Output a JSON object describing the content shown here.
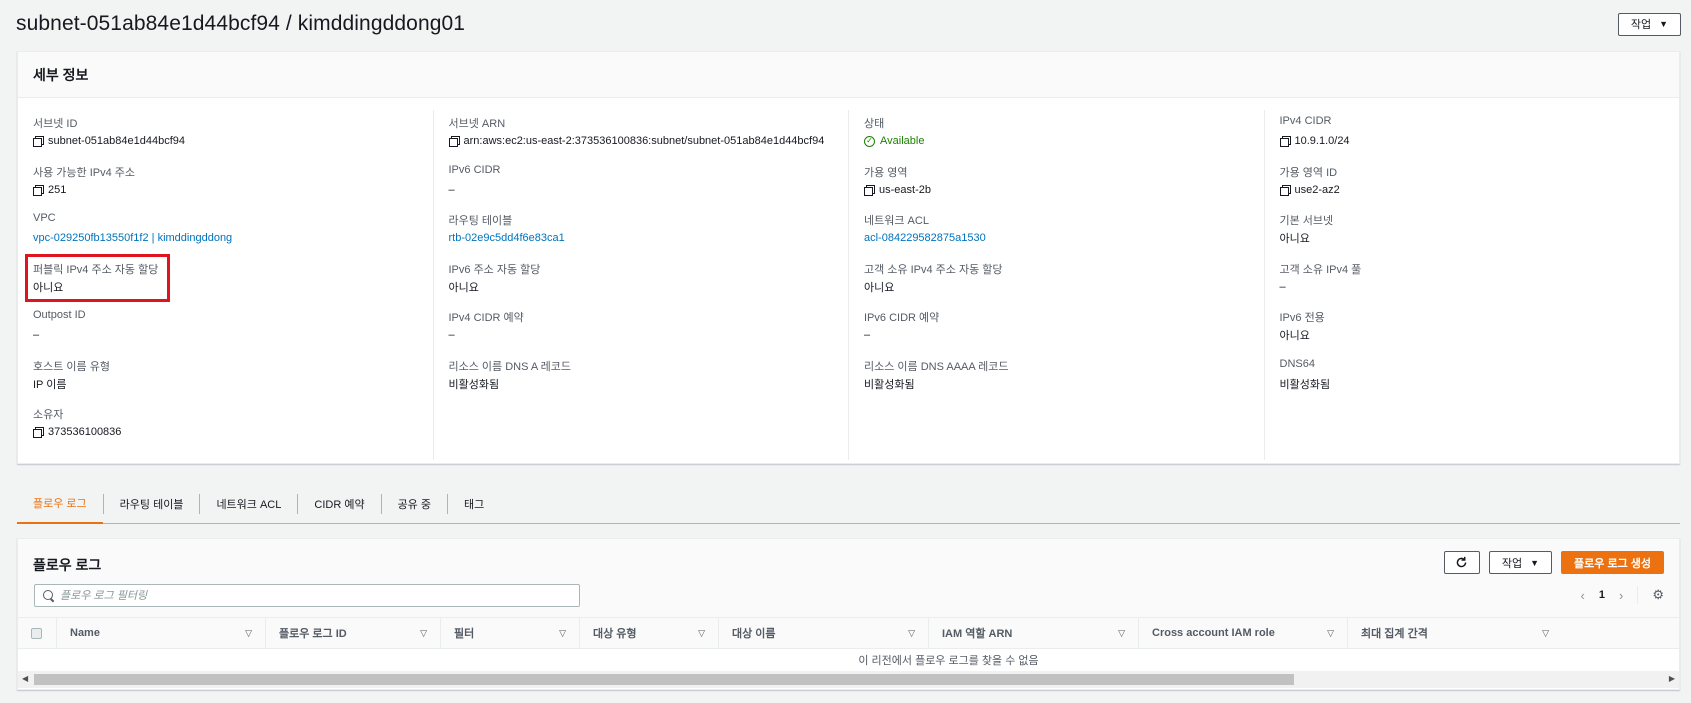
{
  "header": {
    "title": "subnet-051ab84e1d44bcf94 / kimddingddong01",
    "action_label": "작업"
  },
  "details": {
    "title": "세부 정보",
    "columns": [
      [
        {
          "label": "서브넷 ID",
          "value": "subnet-051ab84e1d44bcf94",
          "kind": "copy"
        },
        {
          "label": "사용 가능한 IPv4 주소",
          "value": "251",
          "kind": "copy"
        },
        {
          "label": "VPC",
          "value": "vpc-029250fb13550f1f2 | kimddingddong",
          "kind": "link"
        },
        {
          "label": "퍼블릭 IPv4 주소 자동 할당",
          "value": "아니요",
          "kind": "text"
        },
        {
          "label": "Outpost ID",
          "value": "–",
          "kind": "text"
        },
        {
          "label": "호스트 이름 유형",
          "value": "IP 이름",
          "kind": "text"
        },
        {
          "label": "소유자",
          "value": "373536100836",
          "kind": "copy"
        }
      ],
      [
        {
          "label": "서브넷 ARN",
          "value": "arn:aws:ec2:us-east-2:373536100836:subnet/subnet-051ab84e1d44bcf94",
          "kind": "copy"
        },
        {
          "label": "IPv6 CIDR",
          "value": "–",
          "kind": "text"
        },
        {
          "label": "라우팅 테이블",
          "value": "rtb-02e9c5dd4f6e83ca1",
          "kind": "link"
        },
        {
          "label": "IPv6 주소 자동 할당",
          "value": "아니요",
          "kind": "text"
        },
        {
          "label": "IPv4 CIDR 예약",
          "value": "–",
          "kind": "text"
        },
        {
          "label": "리소스 이름 DNS A 레코드",
          "value": "비활성화됨",
          "kind": "text"
        }
      ],
      [
        {
          "label": "상태",
          "value": "Available",
          "kind": "ok"
        },
        {
          "label": "가용 영역",
          "value": "us-east-2b",
          "kind": "copy"
        },
        {
          "label": "네트워크 ACL",
          "value": "acl-084229582875a1530",
          "kind": "link"
        },
        {
          "label": "고객 소유 IPv4 주소 자동 할당",
          "value": "아니요",
          "kind": "text"
        },
        {
          "label": "IPv6 CIDR 예약",
          "value": "–",
          "kind": "text"
        },
        {
          "label": "리소스 이름 DNS AAAA 레코드",
          "value": "비활성화됨",
          "kind": "text"
        }
      ],
      [
        {
          "label": "IPv4 CIDR",
          "value": "10.9.1.0/24",
          "kind": "copy"
        },
        {
          "label": "가용 영역 ID",
          "value": "use2-az2",
          "kind": "copy"
        },
        {
          "label": "기본 서브넷",
          "value": "아니요",
          "kind": "text"
        },
        {
          "label": "고객 소유 IPv4 풀",
          "value": "–",
          "kind": "text"
        },
        {
          "label": "IPv6 전용",
          "value": "아니요",
          "kind": "text"
        },
        {
          "label": "DNS64",
          "value": "비활성화됨",
          "kind": "text"
        }
      ]
    ]
  },
  "tabs": [
    "플로우 로그",
    "라우팅 테이블",
    "네트워크 ACL",
    "CIDR 예약",
    "공유 중",
    "태그"
  ],
  "flow_logs": {
    "title": "플로우 로그",
    "action_label": "작업",
    "create_label": "플로우 로그 생성",
    "search_placeholder": "플로우 로그 필터링",
    "page": "1",
    "columns": [
      "Name",
      "플로우 로그 ID",
      "필터",
      "대상 유형",
      "대상 이름",
      "IAM 역할 ARN",
      "Cross account IAM role",
      "최대 집계 간격"
    ],
    "empty_text": "이 리전에서 플로우 로그를 찾을 수 없음"
  },
  "colors": {
    "accent": "#ec7211",
    "link": "#0073bb",
    "success": "#1d8102",
    "highlight": "#e0141e"
  }
}
